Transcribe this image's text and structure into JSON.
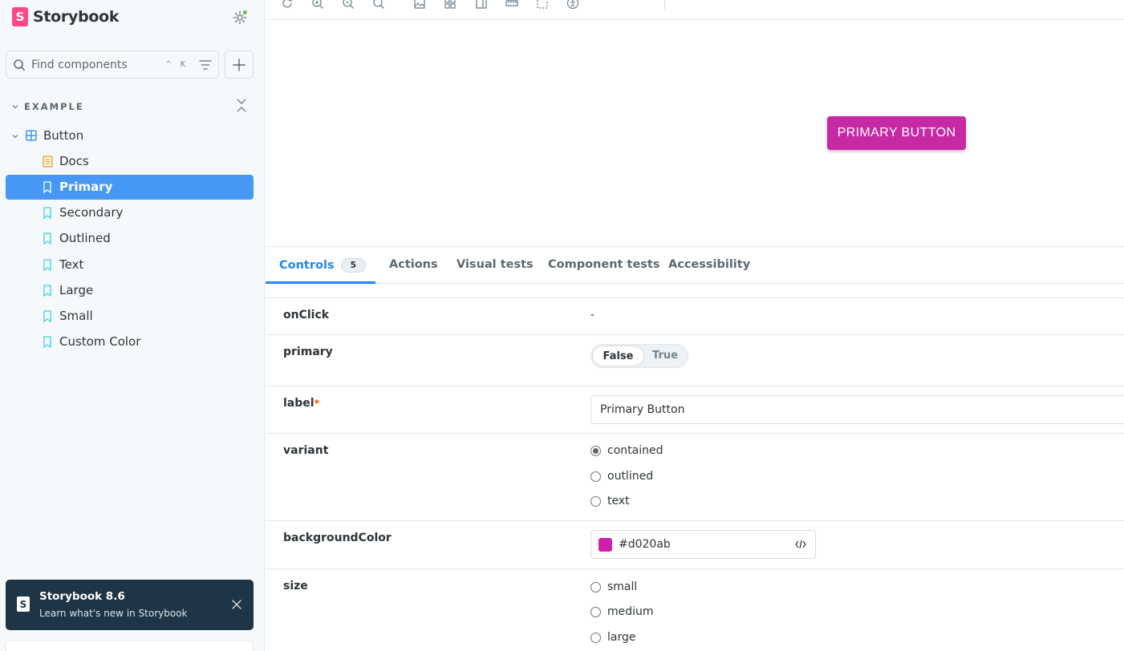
{
  "brand": {
    "name": "Storybook",
    "logo_letter": "S"
  },
  "search": {
    "placeholder": "Find components",
    "shortcut": "^ K"
  },
  "sidebar": {
    "group": "EXAMPLE",
    "component": "Button",
    "items": [
      {
        "label": "Docs",
        "icon": "docs-icon"
      },
      {
        "label": "Primary",
        "icon": "bookmark-icon",
        "active": true
      },
      {
        "label": "Secondary",
        "icon": "bookmark-icon"
      },
      {
        "label": "Outlined",
        "icon": "bookmark-icon"
      },
      {
        "label": "Text",
        "icon": "bookmark-icon"
      },
      {
        "label": "Large",
        "icon": "bookmark-icon"
      },
      {
        "label": "Small",
        "icon": "bookmark-icon"
      },
      {
        "label": "Custom Color",
        "icon": "bookmark-icon"
      }
    ]
  },
  "notice": {
    "title": "Storybook 8.6",
    "subtitle": "Learn what's new in Storybook"
  },
  "preview": {
    "button_label": "PRIMARY BUTTON",
    "button_color": "#c529a3"
  },
  "tabs": {
    "controls": "Controls",
    "controls_count": "5",
    "actions": "Actions",
    "visual_tests": "Visual tests",
    "component_tests": "Component tests",
    "accessibility": "Accessibility"
  },
  "controls": {
    "onClick": {
      "name": "onClick",
      "value": "-"
    },
    "primary": {
      "name": "primary",
      "false_label": "False",
      "true_label": "True"
    },
    "label": {
      "name": "label",
      "required_mark": "*",
      "value": "Primary Button"
    },
    "variant": {
      "name": "variant",
      "options": [
        "contained",
        "outlined",
        "text"
      ],
      "selected": "contained"
    },
    "backgroundColor": {
      "name": "backgroundColor",
      "value": "#d020ab"
    },
    "size": {
      "name": "size",
      "options": [
        "small",
        "medium",
        "large"
      ]
    }
  },
  "colors": {
    "accent": "#1e87f0",
    "selected_bg": "#4698f4",
    "brand": "#ff4785",
    "notice_bg": "#1f3444"
  }
}
